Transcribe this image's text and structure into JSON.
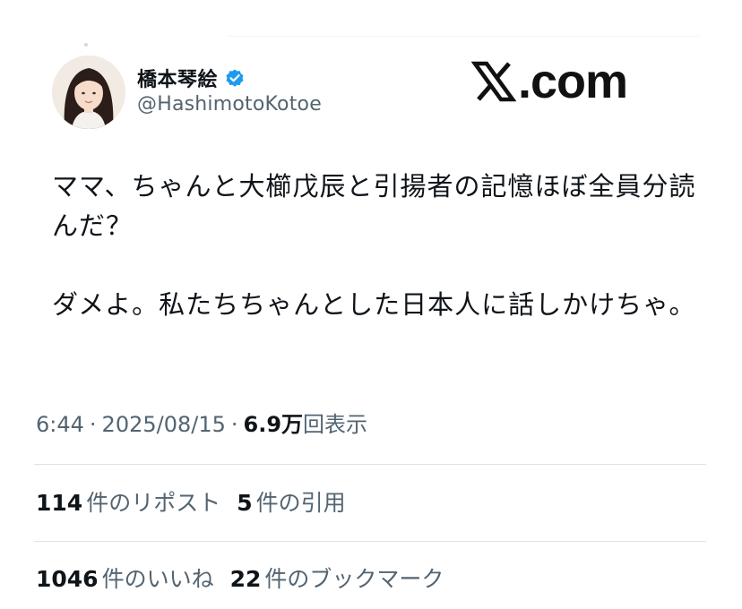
{
  "author": {
    "display_name": "橋本琴絵",
    "handle": "@HashimotoKotoe",
    "verified": true
  },
  "brand": {
    "wordmark": ".com",
    "logo_icon": "x-logo-icon"
  },
  "tweet": {
    "paragraphs": [
      "ママ、ちゃんと大櫛戊辰と引揚者の記憶ほぼ全員分読んだ？",
      "ダメよ。私たちちゃんとした日本人に話しかけちゃ。"
    ]
  },
  "meta": {
    "time": "6:44",
    "separator": "·",
    "date": "2025/08/15",
    "views_count": "6.9万",
    "views_label": "回表示"
  },
  "stats": {
    "reposts": {
      "count": "114",
      "label": "件のリポスト"
    },
    "quotes": {
      "count": "5",
      "label": "件の引用"
    },
    "likes": {
      "count": "1046",
      "label": "件のいいね"
    },
    "bookmarks": {
      "count": "22",
      "label": "件のブックマーク"
    }
  },
  "colors": {
    "text_primary": "#0f1419",
    "text_secondary": "#536471",
    "verified_blue": "#1d9bf0",
    "divider": "#dfe3e6"
  }
}
